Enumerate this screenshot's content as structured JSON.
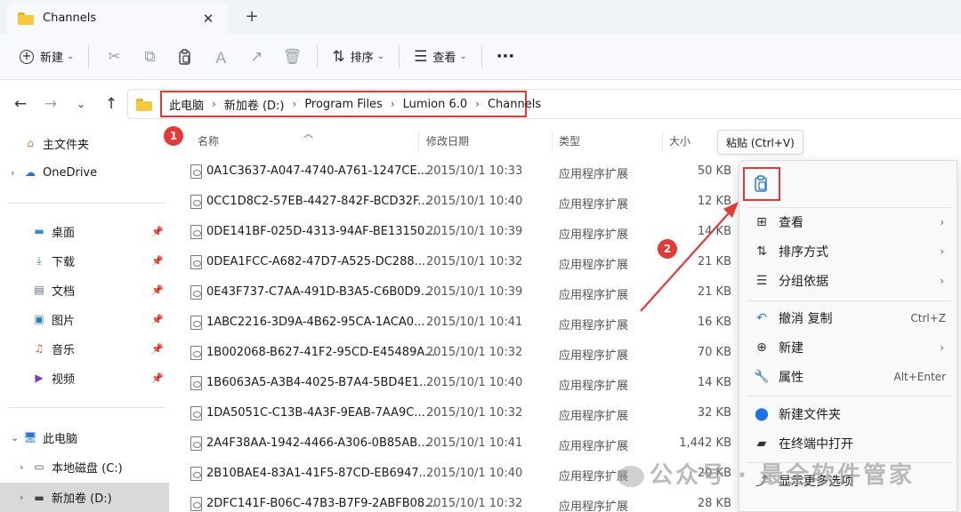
{
  "window": {
    "tab_title": "Channels",
    "tab_close": "✕",
    "new_tab": "+"
  },
  "toolbar": {
    "new_label": "新建",
    "sort_label": "排序",
    "view_label": "查看",
    "more": "···"
  },
  "address": {
    "crumbs": [
      "此电脑",
      "新加卷 (D:)",
      "Program Files",
      "Lumion 6.0",
      "Channels"
    ]
  },
  "annotations": {
    "badge1": "1",
    "badge2": "2",
    "accent_color": "#e53935"
  },
  "sidebar": {
    "home": "主文件夹",
    "onedrive": "OneDrive",
    "desktop": "桌面",
    "downloads": "下载",
    "documents": "文档",
    "pictures": "图片",
    "music": "音乐",
    "videos": "视频",
    "thispc": "此电脑",
    "local_disk": "本地磁盘 (C:)",
    "new_volume": "新加卷 (D:)"
  },
  "columns": {
    "name": "名称",
    "modified": "修改日期",
    "type": "类型",
    "size": "大小"
  },
  "files": [
    {
      "name": "0A1C3637-A047-4740-A761-1247CE...",
      "date": "2015/10/1 10:33",
      "type": "应用程序扩展",
      "size": "50 KB"
    },
    {
      "name": "0CC1D8C2-57EB-4427-842F-BCD32F...",
      "date": "2015/10/1 10:40",
      "type": "应用程序扩展",
      "size": "12 KB"
    },
    {
      "name": "0DE141BF-025D-4313-94AF-BE13150...",
      "date": "2015/10/1 10:39",
      "type": "应用程序扩展",
      "size": "14 KB"
    },
    {
      "name": "0DEA1FCC-A682-47D7-A525-DC288...",
      "date": "2015/10/1 10:32",
      "type": "应用程序扩展",
      "size": "21 KB"
    },
    {
      "name": "0E43F737-C7AA-491D-B3A5-C6B0D9...",
      "date": "2015/10/1 10:39",
      "type": "应用程序扩展",
      "size": "21 KB"
    },
    {
      "name": "1ABC2216-3D9A-4B62-95CA-1ACA0...",
      "date": "2015/10/1 10:41",
      "type": "应用程序扩展",
      "size": "16 KB"
    },
    {
      "name": "1B002068-B627-41F2-95CD-E45489A...",
      "date": "2015/10/1 10:32",
      "type": "应用程序扩展",
      "size": "70 KB"
    },
    {
      "name": "1B6063A5-A3B4-4025-B7A4-5BD4E1...",
      "date": "2015/10/1 10:40",
      "type": "应用程序扩展",
      "size": "14 KB"
    },
    {
      "name": "1DA5051C-C13B-4A3F-9EAB-7AA9C...",
      "date": "2015/10/1 10:32",
      "type": "应用程序扩展",
      "size": "32 KB"
    },
    {
      "name": "2A4F38AA-1942-4466-A306-0B85AB...",
      "date": "2015/10/1 10:41",
      "type": "应用程序扩展",
      "size": "1,442 KB"
    },
    {
      "name": "2B10BAE4-83A1-41F5-87CD-EB6947...",
      "date": "2015/10/1 10:40",
      "type": "应用程序扩展",
      "size": "20 KB"
    },
    {
      "name": "2DFC141F-B06C-47B3-B7F9-2ABFB08...",
      "date": "2015/10/1 10:32",
      "type": "应用程序扩展",
      "size": "28 KB"
    }
  ],
  "tooltip": {
    "text": "粘贴 (Ctrl+V)"
  },
  "context_menu": {
    "view": "查看",
    "sort_by": "排序方式",
    "group_by": "分组依据",
    "undo": "撤消 复制",
    "undo_shortcut": "Ctrl+Z",
    "new": "新建",
    "properties": "属性",
    "properties_shortcut": "Alt+Enter",
    "new_folder": "新建文件夹",
    "open_terminal": "在终端中打开",
    "show_more": "显示更多选项"
  },
  "watermark": {
    "text": "公众号 · 最全软件管家"
  }
}
